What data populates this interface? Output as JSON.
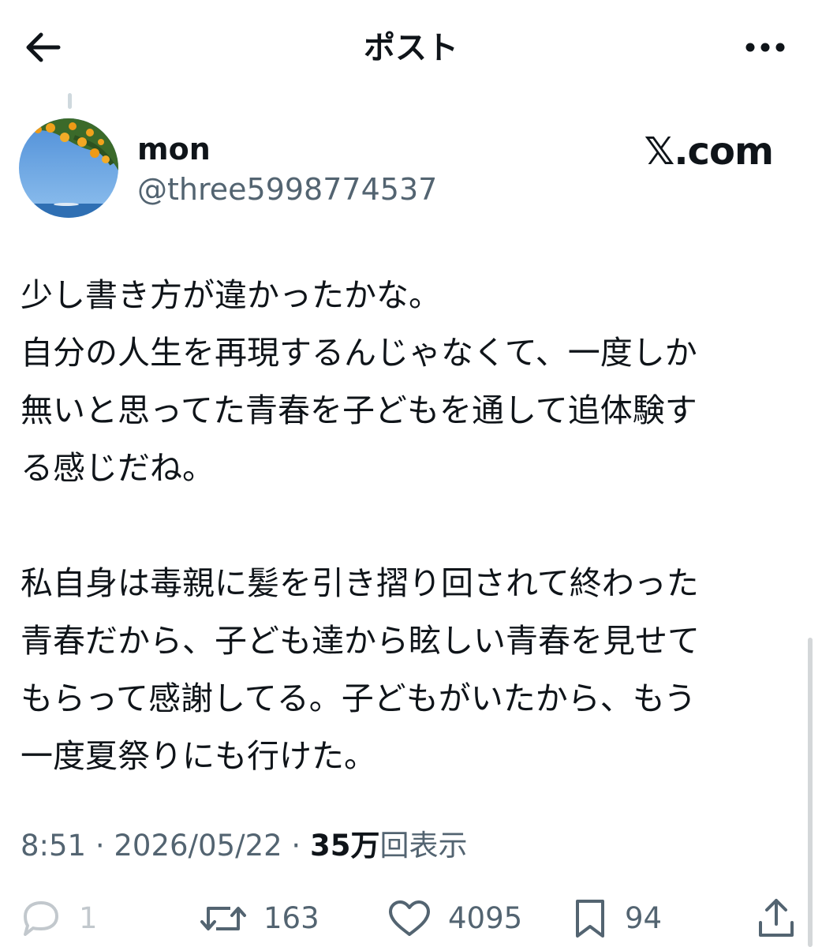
{
  "header": {
    "title": "ポスト",
    "back_icon": "arrow-left-icon",
    "more_icon": "more-horizontal-icon"
  },
  "author": {
    "display_name": "mon",
    "handle": "@three5998774537"
  },
  "watermark": "𝕏.com",
  "post": {
    "paragraphs": [
      [
        "少し書き方が違かったかな。",
        "自分の人生を再現するんじゃなくて、一度しか",
        "無いと思ってた青春を子どもを通して追体験す",
        "る感じだね。"
      ],
      [
        "私自身は毒親に髪を引き摺り回されて終わった",
        "青春だから、子ども達から眩しい青春を見せて",
        "もらって感謝してる。子どもがいたから、もう",
        "一度夏祭りにも行けた。"
      ]
    ]
  },
  "meta": {
    "time": "8:51",
    "sep1": " · ",
    "date": "2026/05/22",
    "sep2": " · ",
    "views_count": "35万",
    "views_label": "回表示"
  },
  "actions": {
    "reply_count": "1",
    "repost_count": "163",
    "like_count": "4095",
    "bookmark_count": "94"
  },
  "colors": {
    "text": "#0f1419",
    "secondary": "#536471",
    "background": "#ffffff"
  }
}
